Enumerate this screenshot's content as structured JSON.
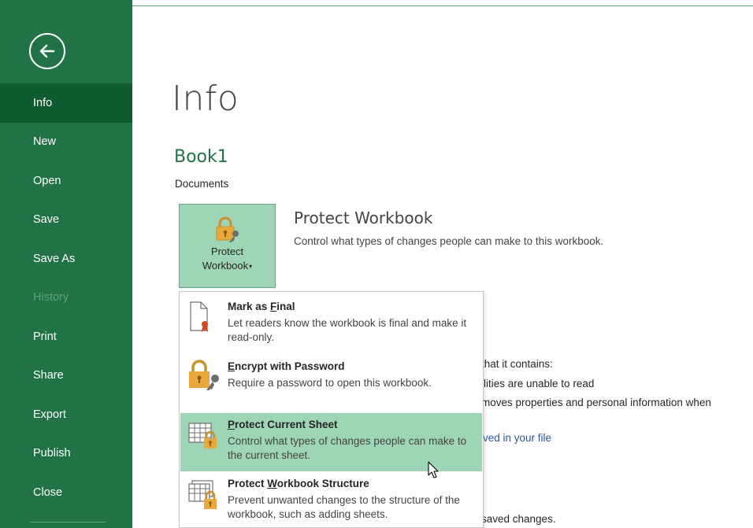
{
  "sidebar": {
    "items": [
      {
        "label": "Info"
      },
      {
        "label": "New"
      },
      {
        "label": "Open"
      },
      {
        "label": "Save"
      },
      {
        "label": "Save As"
      },
      {
        "label": "History"
      },
      {
        "label": "Print"
      },
      {
        "label": "Share"
      },
      {
        "label": "Export"
      },
      {
        "label": "Publish"
      },
      {
        "label": "Close"
      }
    ],
    "active_item": "Info",
    "disabled_item": "History"
  },
  "main": {
    "title": "Info",
    "document_name": "Book1",
    "document_location": "Documents",
    "protect": {
      "button_label_line1": "Protect",
      "button_label_line2": "Workbook",
      "caret": "▾",
      "section_title": "Protect Workbook",
      "section_description": "Control what types of changes people can make to this workbook."
    },
    "background_fragments": {
      "line1": "that it contains:",
      "line2": "ilities are unable to read",
      "line3": "moves properties and personal information when",
      "link": "ved in your file",
      "line5": "saved changes."
    }
  },
  "dropdown": {
    "items": [
      {
        "title_before": "Mark as ",
        "title_accel": "F",
        "title_after": "inal",
        "description": "Let readers know the workbook is final and make it read-only.",
        "icon": "mark-as-final-icon"
      },
      {
        "title_before": "",
        "title_accel": "E",
        "title_after": "ncrypt with Password",
        "description": "Require a password to open this workbook.",
        "icon": "encrypt-lock-icon"
      },
      {
        "title_before": "",
        "title_accel": "P",
        "title_after": "rotect Current Sheet",
        "description": "Control what types of changes people can make to the current sheet.",
        "icon": "protect-sheet-icon"
      },
      {
        "title_before": "Protect ",
        "title_accel": "W",
        "title_after": "orkbook Structure",
        "description": "Prevent unwanted changes to the structure of the workbook, such as adding sheets.",
        "icon": "protect-structure-icon"
      }
    ],
    "highlighted_index": 2
  },
  "colors": {
    "sidebar_bg": "#217346",
    "sidebar_active": "#0e5c2f",
    "accent_green": "#217346",
    "highlight": "#9fd5b7",
    "link": "#2b579a"
  }
}
